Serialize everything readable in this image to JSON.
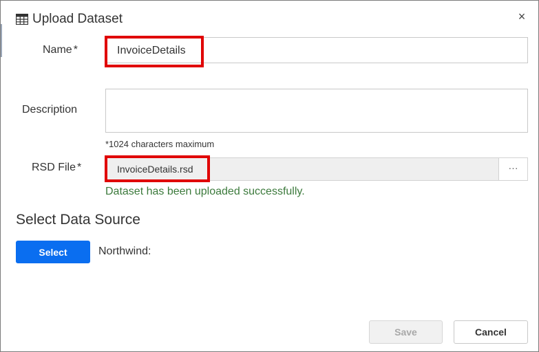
{
  "dialog": {
    "title": "Upload Dataset",
    "title_icon": "table-icon",
    "close_icon": "close-icon",
    "close_glyph": "×"
  },
  "form": {
    "name_label": "Name",
    "name_required_marker": "*",
    "name_value": "InvoiceDetails",
    "description_label": "Description",
    "description_value": "",
    "description_hint": "*1024 characters maximum",
    "rsd_label": "RSD File",
    "rsd_required_marker": "*",
    "rsd_value": "InvoiceDetails.rsd",
    "browse_label": "···",
    "success_message": "Dataset has been uploaded successfully."
  },
  "data_source": {
    "section_title": "Select Data Source",
    "select_label": "Select",
    "selected_source": "Northwind:"
  },
  "footer": {
    "save_label": "Save",
    "cancel_label": "Cancel",
    "save_enabled": false
  },
  "colors": {
    "accent": "#0a6ef0",
    "highlight": "#e00000",
    "success": "#3c7a3c"
  }
}
